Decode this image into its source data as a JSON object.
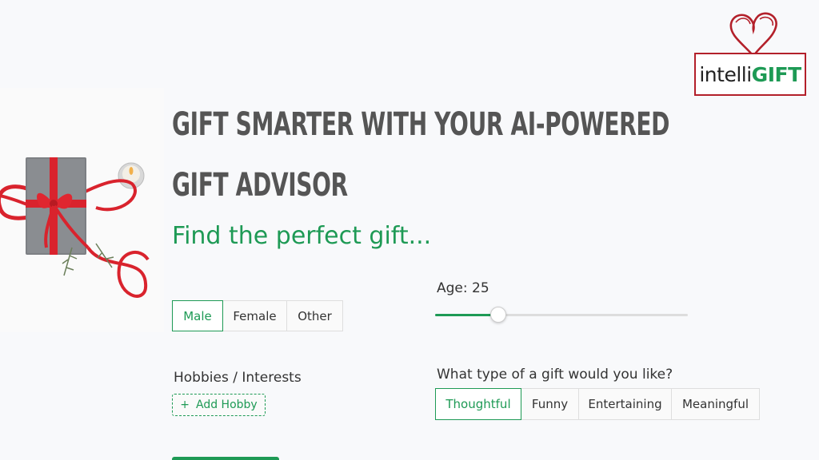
{
  "logo": {
    "text_light": "intelli",
    "text_bold": "GIFT"
  },
  "headline": "Gift smarter with your AI-powered gift advisor",
  "tagline": "Find the perfect gift...",
  "gender": {
    "options": [
      "Male",
      "Female",
      "Other"
    ],
    "selected": "Male"
  },
  "age": {
    "label": "Age: 25",
    "value": 25,
    "min": 0,
    "max": 100
  },
  "hobbies": {
    "label": "Hobbies / Interests",
    "add_label": "Add Hobby",
    "add_icon": "plus-icon"
  },
  "gift_type": {
    "label": "What type of a gift would you like?",
    "options": [
      "Thoughtful",
      "Funny",
      "Entertaining",
      "Meaningful"
    ],
    "selected": "Thoughtful"
  },
  "colors": {
    "accent": "#1e9a55",
    "logo_red": "#b3202a",
    "headline": "#555555"
  }
}
